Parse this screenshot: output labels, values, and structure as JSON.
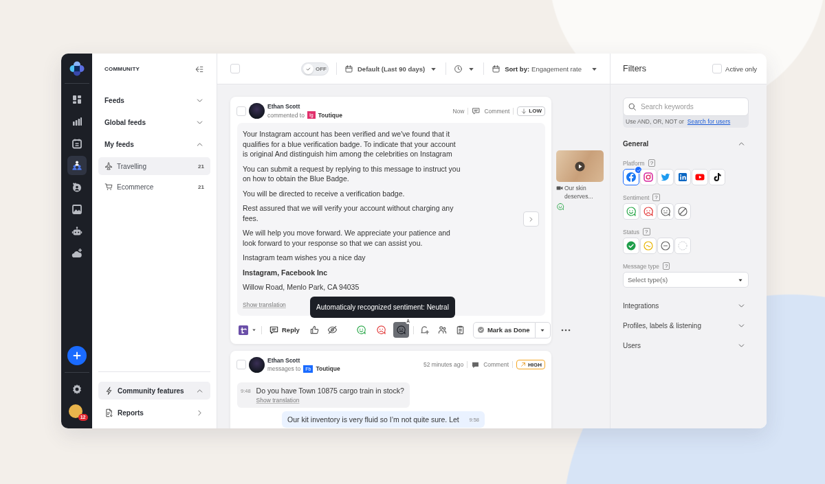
{
  "rail": {
    "items": [
      {
        "kind": "dashboard",
        "selected": false
      },
      {
        "kind": "analytics",
        "selected": false
      },
      {
        "kind": "calendar",
        "selected": false
      },
      {
        "kind": "community",
        "selected": true
      },
      {
        "kind": "care",
        "selected": false
      },
      {
        "kind": "media",
        "selected": false
      },
      {
        "kind": "bot",
        "selected": false
      },
      {
        "kind": "weather",
        "selected": false
      }
    ],
    "notifications": "12"
  },
  "sidebar": {
    "title": "COMMUNITY",
    "sections": [
      {
        "label": "Feeds",
        "expanded": false
      },
      {
        "label": "Global feeds",
        "expanded": false
      },
      {
        "label": "My feeds",
        "expanded": true,
        "children": [
          {
            "kind": "plane",
            "label": "Travelling",
            "count": "21",
            "selected": true
          },
          {
            "kind": "cart",
            "label": "Ecommerce",
            "count": "21",
            "selected": false
          }
        ]
      }
    ],
    "footer": [
      {
        "kind": "features",
        "label": "Community features",
        "expanded": true
      },
      {
        "kind": "reports",
        "label": "Reports",
        "expanded": false
      }
    ]
  },
  "toolbar": {
    "select_all": {
      "checked": false
    },
    "toggle": {
      "label": "OFF",
      "on": false
    },
    "date": "Default (Last 90 days)",
    "sort": {
      "label": "Sort by:",
      "value": "Engagement rate"
    }
  },
  "posts": [
    {
      "checked": false,
      "author": "Ethan Scott",
      "action": "commented to",
      "network": {
        "kind": "instagram",
        "label": "Ig"
      },
      "account": "Toutique",
      "time": "Now",
      "type": "Comment",
      "priority": {
        "kind": "low",
        "label": "LOW"
      },
      "paragraphs": [
        {
          "text": "Your Instagram account has been verified and we've found that it qualifies for a blue verification badge. To indicate that your account is original And distinguish him among the celebrities on Instagram",
          "bold": false
        },
        {
          "text": "You can submit a request by replying to this message to instruct you on how to obtain the Blue Badge.",
          "bold": false
        },
        {
          "text": "You will be directed to receive a verification badge.",
          "bold": false
        },
        {
          "text": "Rest assured that we will verify your account without charging any fees.",
          "bold": false
        },
        {
          "text": "We will help you move forward. We appreciate your patience and look forward to your response so that we can assist you.",
          "bold": false
        },
        {
          "text": "Instagram team wishes you a nice day",
          "bold": false
        },
        {
          "text": "Instagram, Facebook Inc",
          "bold": true
        },
        {
          "text": "Willow Road, Menlo Park, CA 94035",
          "bold": false
        }
      ],
      "translation": "Show translation",
      "tooltip": "Automaticaly recognized sentiment: Neutral",
      "reply": "Reply",
      "sentiments": [
        {
          "kind": "positive",
          "selected": false
        },
        {
          "kind": "negative",
          "selected": false
        },
        {
          "kind": "neutral",
          "selected": true
        }
      ],
      "auto_badge": "A",
      "done": "Mark as Done"
    },
    {
      "checked": false,
      "author": "Ethan Scott",
      "action": "messages to",
      "network": {
        "kind": "facebook",
        "label": "Fb"
      },
      "account": "Toutique",
      "time": "52 minutes ago",
      "type": "Comment",
      "priority": {
        "kind": "high",
        "label": "HIGH"
      },
      "messages": [
        {
          "kind": "incoming",
          "time": "9:48",
          "text": "Do you have Town 10875 cargo train in stock?",
          "translation": "Show translation"
        },
        {
          "kind": "outgoing",
          "time": "9:58",
          "text": "Our kit inventory is very fluid so I’m not quite sure. Let"
        }
      ]
    }
  ],
  "preview": {
    "caption": "Our skin deserves...",
    "sentiment": {
      "kind": "positive"
    }
  },
  "filters": {
    "title": "Filters",
    "active_only": {
      "label": "Active only",
      "checked": false
    },
    "search": {
      "placeholder": "Search keywords",
      "hint": "Use AND, OR, NOT or",
      "link": "Search for users"
    },
    "general": {
      "title": "General",
      "expanded": true,
      "platform": {
        "label": "Platform",
        "help": "?",
        "items": [
          {
            "kind": "facebook",
            "selected": true
          },
          {
            "kind": "instagram",
            "selected": false
          },
          {
            "kind": "twitter",
            "selected": false
          },
          {
            "kind": "linkedin",
            "selected": false
          },
          {
            "kind": "youtube",
            "selected": false
          },
          {
            "kind": "tiktok",
            "selected": false
          }
        ]
      },
      "sentiment": {
        "label": "Sentiment",
        "help": "?",
        "items": [
          {
            "kind": "positive",
            "selected": false
          },
          {
            "kind": "negative",
            "selected": false
          },
          {
            "kind": "neutral",
            "selected": false
          },
          {
            "kind": "none",
            "selected": false
          }
        ]
      },
      "status": {
        "label": "Status",
        "help": "?",
        "items": [
          {
            "kind": "done",
            "selected": false
          },
          {
            "kind": "pending",
            "selected": false
          },
          {
            "kind": "neutral",
            "selected": false
          },
          {
            "kind": "none",
            "selected": false
          }
        ]
      },
      "message_type": {
        "label": "Message type",
        "help": "?",
        "placeholder": "Select type(s)"
      }
    },
    "sections": [
      {
        "label": "Integrations",
        "expanded": false
      },
      {
        "label": "Profiles, labels & listening",
        "expanded": false
      },
      {
        "label": "Users",
        "expanded": false
      }
    ]
  }
}
